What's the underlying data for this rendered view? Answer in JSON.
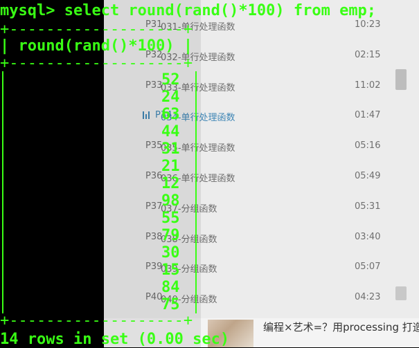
{
  "background_window": {
    "playlist": [
      {
        "index": "P31",
        "title": "031-单行处理函数",
        "time": "10:23",
        "active": false
      },
      {
        "index": "P32",
        "title": "032-单行处理函数",
        "time": "02:15",
        "active": false
      },
      {
        "index": "P33",
        "title": "033-单行处理函数",
        "time": "11:02",
        "active": false
      },
      {
        "index": "P34",
        "title": "034-单行处理函数",
        "time": "01:47",
        "active": true
      },
      {
        "index": "P35",
        "title": "035-单行处理函数",
        "time": "05:16",
        "active": false
      },
      {
        "index": "P36",
        "title": "036-单行处理函数",
        "time": "05:49",
        "active": false
      },
      {
        "index": "P37",
        "title": "037-分组函数",
        "time": "05:31",
        "active": false
      },
      {
        "index": "P38",
        "title": "038-分组函数",
        "time": "03:40",
        "active": false
      },
      {
        "index": "P39",
        "title": "039-分组函数",
        "time": "05:07",
        "active": false
      },
      {
        "index": "P40",
        "title": "040-分组函数",
        "time": "04:23",
        "active": false
      }
    ],
    "promo_text": "编程×艺术=？用processing 打造梦幻作品，你也可以！"
  },
  "terminal": {
    "prompt": "mysql> select round(rand()*100) from emp;",
    "separator": "+-------------------+",
    "header": "| round(rand()*100) |",
    "values": [
      "52",
      "24",
      "63",
      "44",
      "31",
      "21",
      "12",
      "98",
      "55",
      "79",
      "30",
      "15",
      "84",
      "75"
    ],
    "footer": "14 rows in set (0.00 sec)"
  },
  "colors": {
    "terminal_text": "#39ff14",
    "terminal_bg": "#000000",
    "playlist_bg": "#ececec",
    "playlist_active": "#3f86b5"
  }
}
